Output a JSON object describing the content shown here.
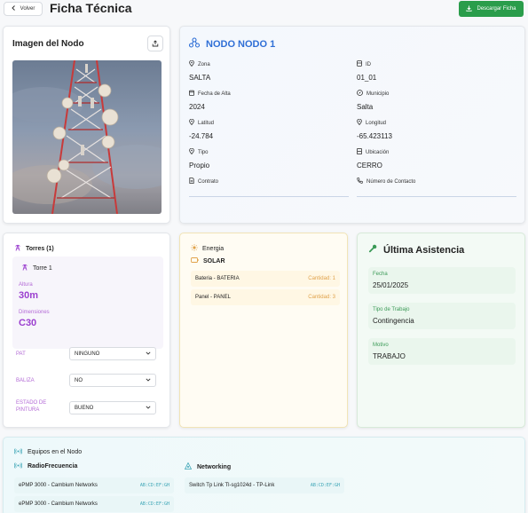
{
  "header": {
    "back_label": "Volver",
    "title": "Ficha Técnica",
    "download_label": "Descargar Ficha"
  },
  "image_card": {
    "title": "Imagen del Nodo"
  },
  "node": {
    "title": "NODO NODO 1",
    "fields": {
      "zona": {
        "label": "Zona",
        "value": "SALTA"
      },
      "id": {
        "label": "ID",
        "value": "01_01"
      },
      "fecha_alta": {
        "label": "Fecha de Alta",
        "value": "2024"
      },
      "municipio": {
        "label": "Municipio",
        "value": "Salta"
      },
      "latitud": {
        "label": "Latitud",
        "value": "-24.784"
      },
      "longitud": {
        "label": "Longitud",
        "value": "-65.423113"
      },
      "tipo": {
        "label": "Tipo",
        "value": "Propio"
      },
      "ubicacion": {
        "label": "Ubicación",
        "value": "CERRO"
      },
      "contrato": {
        "label": "Contrato",
        "value": ""
      },
      "contacto": {
        "label": "Número de Contacto",
        "value": ""
      }
    }
  },
  "torres": {
    "title": "Torres (1)",
    "torre": {
      "name": "Torre 1",
      "altura_label": "Altura",
      "altura_value": "30m",
      "dimensiones_label": "Dimensiones",
      "dimensiones_value": "C30"
    },
    "selects": [
      {
        "label": "PAT",
        "value": "NINGUNO"
      },
      {
        "label": "BALIZA",
        "value": "NO"
      },
      {
        "label": "ESTADO DE PINTURA",
        "value": "BUENO"
      }
    ]
  },
  "energia": {
    "title": "Energia",
    "subtitle": "SOLAR",
    "items": [
      {
        "name": "Bateria - BATERIA",
        "qty": "Cantidad: 1"
      },
      {
        "name": "Panel - PANEL",
        "qty": "Cantidad: 3"
      }
    ]
  },
  "asistencia": {
    "title": "Última Asistencia",
    "fecha": {
      "label": "Fecha",
      "value": "25/01/2025"
    },
    "tipo": {
      "label": "Tipo de Trabajo",
      "value": "Contingencia"
    },
    "motivo": {
      "label": "Motivo",
      "value": "TRABAJO"
    }
  },
  "equipos": {
    "title": "Equipos en el Nodo",
    "radio": {
      "title": "RadioFrecuencia",
      "items": [
        {
          "name": "ePMP 3000 - Cambium Networks",
          "mac": "AB:CD:EF:GH"
        },
        {
          "name": "ePMP 3000 - Cambium Networks",
          "mac": "AB:CD:EF:GH"
        }
      ]
    },
    "networking": {
      "title": "Networking",
      "items": [
        {
          "name": "Switch Tp Link Tl-sg1024d - TP-Link",
          "mac": "AB:CD:EF:GH"
        }
      ]
    }
  },
  "colors": {
    "accent_green": "#2a9d4b",
    "node_blue": "#2f6fd6",
    "torre_purple": "#9b3fcf",
    "energia_orange": "#e0a24a",
    "equipos_teal": "#3aa4b5"
  }
}
